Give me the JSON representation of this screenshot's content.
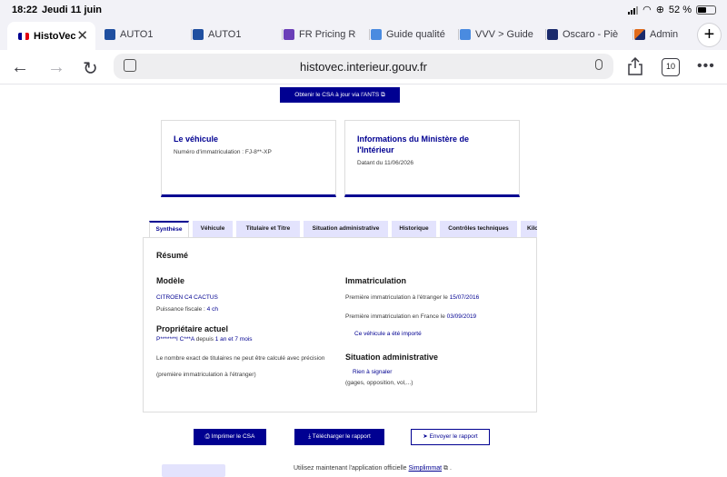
{
  "status_bar": {
    "time": "18:22",
    "date": "Jeudi 11 juin",
    "battery": "52 %"
  },
  "browser_tabs": [
    {
      "label": "HistoVec",
      "active": true,
      "color": "#e1000f"
    },
    {
      "label": "AUTO1",
      "active": false,
      "color": "#1f4fa0"
    },
    {
      "label": "AUTO1",
      "active": false,
      "color": "#1f4fa0"
    },
    {
      "label": "FR Pricing Re",
      "active": false,
      "color": "#6b3fb8"
    },
    {
      "label": "Guide qualité",
      "active": false,
      "color": "#4a8be0"
    },
    {
      "label": "VVV > Guide",
      "active": false,
      "color": "#4a8be0"
    },
    {
      "label": "Oscaro - Piè",
      "active": false,
      "color": "#1a2a6c"
    },
    {
      "label": "Admin",
      "active": false,
      "color": "#e06a1a"
    }
  ],
  "toolbar": {
    "url": "histovec.interieur.gouv.fr",
    "tab_count": "10"
  },
  "page": {
    "csa_button": "Obtenir le CSA à jour via l'ANTS",
    "vehicle_card": {
      "title": "Le véhicule",
      "subtitle": "Numéro d'immatriculation : FJ-8**-XP"
    },
    "ministry_card": {
      "title": "Informations du Ministère de l'Intérieur",
      "subtitle": "Datant du 11/06/2026"
    },
    "tabs": [
      "Synthèse",
      "Véhicule",
      "Titulaire et Titre",
      "Situation administrative",
      "Historique",
      "Contrôles techniques",
      "Kilo"
    ],
    "summary": {
      "heading": "Résumé",
      "model_heading": "Modèle",
      "model_name": "CITROEN C4 CACTUS",
      "fiscal_label": "Puissance fiscale :",
      "fiscal_value": "4 ch",
      "owner_heading": "Propriétaire actuel",
      "owner_name": "P*******I C***A",
      "owner_since": "depuis",
      "owner_duration": "1 an et 7 mois",
      "owner_note_1": "Le nombre exact de titulaires ne peut être calculé avec précision",
      "owner_note_2": "(première immatriculation à l'étranger)",
      "immat_heading": "Immatriculation",
      "first_foreign": "Première immatriculation à l'étranger le",
      "first_foreign_date": "15/07/2016",
      "first_france": "Première immatriculation en France le",
      "first_france_date": "03/09/2019",
      "imported_label": "Ce véhicule a été importé",
      "admin_heading": "Situation administrative",
      "admin_status": "Rien à signaler",
      "admin_note": "(gages, opposition, vol,...)"
    },
    "actions": {
      "print": "Imprimer le CSA",
      "download": "Télécharger le rapport",
      "send": "Envoyer le rapport"
    },
    "footer": {
      "text": "Utilisez maintenant l'application officielle",
      "link": "Simplimmat"
    }
  }
}
